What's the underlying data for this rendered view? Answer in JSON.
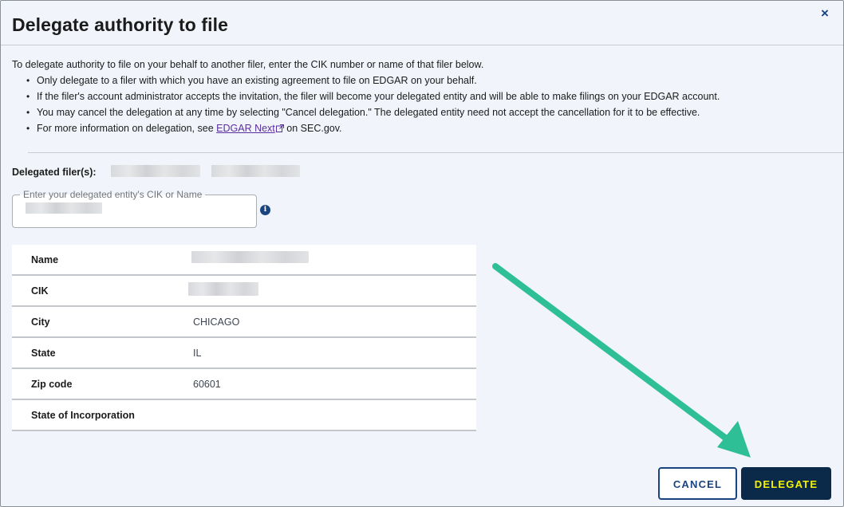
{
  "dialog": {
    "title": "Delegate authority to file",
    "close_symbol": "×",
    "intro": "To delegate authority to file on your behalf to another filer, enter the CIK number or name of that filer below.",
    "bullets": [
      "Only delegate to a filer with which you have an existing agreement to file on EDGAR on your behalf.",
      "If the filer's account administrator accepts the invitation, the filer will become your delegated entity and will be able to make filings on your EDGAR account.",
      "You may cancel the delegation at any time by selecting \"Cancel delegation.\" The delegated entity need not accept the cancellation for it to be effective."
    ],
    "more_info_prefix": "For more information on delegation, see",
    "more_info_link": "EDGAR Next",
    "more_info_suffix": "on SEC.gov."
  },
  "filers": {
    "label": "Delegated filer(s):"
  },
  "search": {
    "legend": "Enter your delegated entity's CIK or Name"
  },
  "details": [
    {
      "label": "Name",
      "value": ""
    },
    {
      "label": "CIK",
      "value": ""
    },
    {
      "label": "City",
      "value": "CHICAGO"
    },
    {
      "label": "State",
      "value": "IL"
    },
    {
      "label": "Zip code",
      "value": "60601"
    },
    {
      "label": "State of Incorporation",
      "value": ""
    }
  ],
  "actions": {
    "cancel_label": "CANCEL",
    "delegate_label": "DELEGATE"
  },
  "colors": {
    "accent": "#1a4480",
    "delegate_bg": "#0b2a4a",
    "delegate_text": "#f5f300",
    "annotation_arrow": "#2fbf96"
  },
  "icons": [
    "close-icon",
    "external-link-icon",
    "info-icon",
    "annotation-arrow"
  ]
}
